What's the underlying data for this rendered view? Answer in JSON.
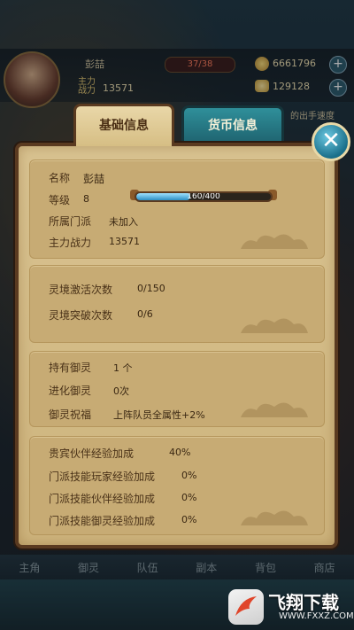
{
  "topbar": {
    "player_name": "彭喆",
    "power_label": "主力战力",
    "power_value": "13571",
    "stamina": "37/38",
    "coins": "6661796",
    "ingots": "129128",
    "hint": "的出手速度"
  },
  "tabs": [
    {
      "label": "基础信息",
      "active": true
    },
    {
      "label": "货币信息",
      "active": false
    }
  ],
  "basic": {
    "name_label": "名称",
    "name_value": "彭喆",
    "level_label": "等级",
    "level_value": "8",
    "xp_text": "160/400",
    "xp_ratio": 0.4,
    "sect_label": "所属门派",
    "sect_value": "未加入",
    "power_label": "主力战力",
    "power_value": "13571"
  },
  "realm": {
    "activate_label": "灵境激活次数",
    "activate_value": "0/150",
    "breakthrough_label": "灵境突破次数",
    "breakthrough_value": "0/6"
  },
  "spirit": {
    "owned_label": "持有御灵",
    "owned_value": "1 个",
    "evolved_label": "进化御灵",
    "evolved_value": "0次",
    "blessing_label": "御灵祝福",
    "blessing_value": "上阵队员全属性+2%"
  },
  "bonus": {
    "rows": [
      {
        "label": "贵宾伙伴经验加成",
        "value": "40%"
      },
      {
        "label": "门派技能玩家经验加成",
        "value": "0%"
      },
      {
        "label": "门派技能伙伴经验加成",
        "value": "0%"
      },
      {
        "label": "门派技能御灵经验加成",
        "value": "0%"
      }
    ]
  },
  "bottom_nav": [
    "主角",
    "御灵",
    "队伍",
    "副本",
    "背包",
    "商店"
  ],
  "watermark": {
    "text": "飞翔下载",
    "url": "WWW.FXXZ.COM"
  },
  "colors": {
    "panel": "#d9c391",
    "border": "#5a3a20",
    "active_tab": "#e9d7a8",
    "inactive_tab": "#2f8f9a",
    "xp_fill": "#2c8fc4"
  }
}
